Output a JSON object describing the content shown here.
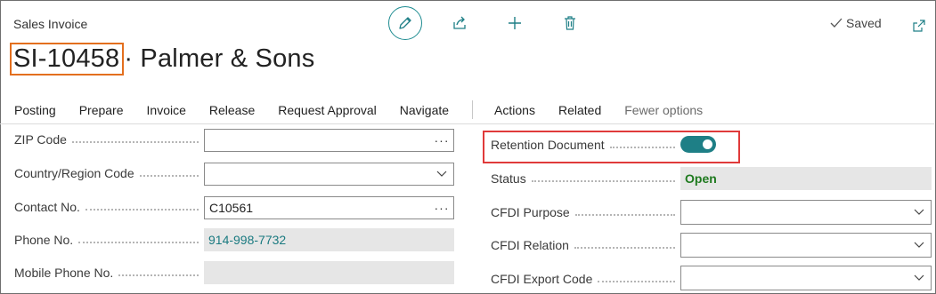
{
  "header": {
    "caption": "Sales Invoice",
    "doc_no": "SI-10458",
    "title_rest": "· Palmer & Sons",
    "saved": "Saved"
  },
  "toolbar": {
    "edit_icon": "pencil-icon",
    "share_icon": "share-icon",
    "new_icon": "plus-icon",
    "delete_icon": "trash-icon",
    "saved_icon": "checkmark-icon",
    "popout_icon": "open-in-new-window-icon"
  },
  "actions": {
    "items": [
      "Posting",
      "Prepare",
      "Invoice",
      "Release",
      "Request Approval",
      "Navigate"
    ],
    "secondary": [
      "Actions",
      "Related"
    ],
    "fewer": "Fewer options"
  },
  "left_fields": [
    {
      "label": "ZIP Code",
      "value": "",
      "control": "lookup"
    },
    {
      "label": "Country/Region Code",
      "value": "",
      "control": "dropdown"
    },
    {
      "label": "Contact No.",
      "value": "C10561",
      "control": "lookup"
    },
    {
      "label": "Phone No.",
      "value": "914-998-7732",
      "control": "readonly-link"
    },
    {
      "label": "Mobile Phone No.",
      "value": "",
      "control": "readonly"
    }
  ],
  "right_fields": [
    {
      "label": "Retention Document",
      "value": true,
      "control": "toggle"
    },
    {
      "label": "Status",
      "value": "Open",
      "control": "readonly"
    },
    {
      "label": "CFDI Purpose",
      "value": "",
      "control": "dropdown"
    },
    {
      "label": "CFDI Relation",
      "value": "",
      "control": "dropdown"
    },
    {
      "label": "CFDI Export Code",
      "value": "",
      "control": "dropdown"
    }
  ],
  "colors": {
    "accent": "#1e7f86",
    "highlight_title": "#e36f1e",
    "highlight_field": "#e03a3a",
    "status_open": "#1f7a1f",
    "link": "#1a7a80"
  }
}
